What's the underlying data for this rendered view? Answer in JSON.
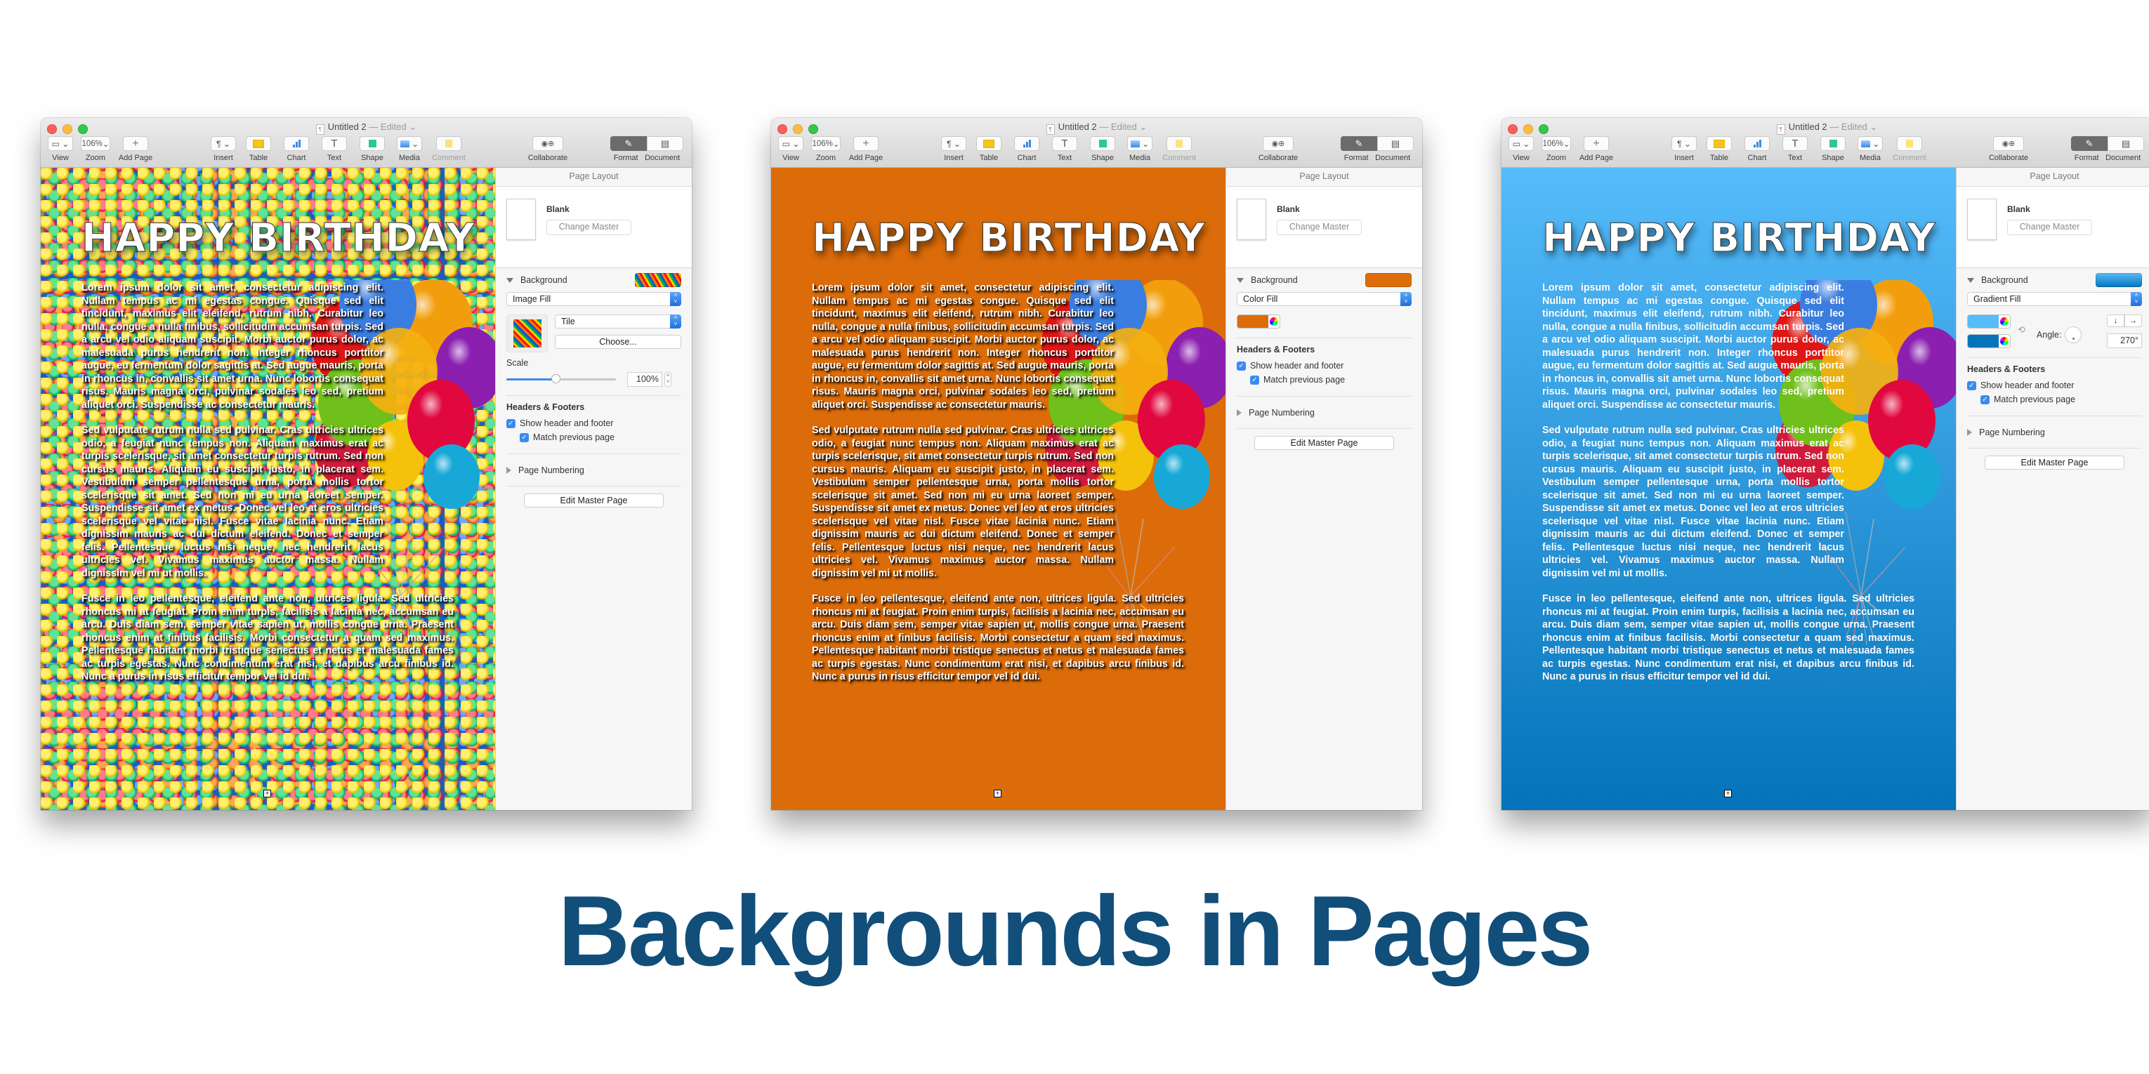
{
  "caption": "Backgrounds in Pages",
  "window": {
    "title": "Untitled 2",
    "title_separator": "—",
    "edited": "Edited",
    "toolbar": {
      "view": "View",
      "zoom_value": "106%",
      "zoom": "Zoom",
      "add_page": "Add Page",
      "insert": "Insert",
      "table": "Table",
      "chart": "Chart",
      "text": "Text",
      "shape": "Shape",
      "media": "Media",
      "comment": "Comment",
      "collaborate": "Collaborate",
      "format": "Format",
      "document": "Document"
    }
  },
  "document": {
    "heading": "HAPPY BIRTHDAY",
    "paragraphs": [
      "Lorem ipsum dolor sit amet, consectetur adipiscing elit. Nullam tempus ac mi egestas congue. Quisque sed elit tincidunt, maximus elit eleifend, rutrum nibh. Curabitur leo nulla, congue a nulla finibus, sollicitudin accumsan turpis. Sed a arcu vel odio aliquam suscipit. Morbi auctor purus dolor, ac malesuada purus hendrerit non. Integer rhoncus porttitor augue, eu fermentum dolor sagittis at. Sed augue mauris, porta in rhoncus in, convallis sit amet urna. Nunc lobortis consequat risus. Mauris magna orci, pulvinar sodales leo sed, pretium aliquet orci. Suspendisse ac consectetur mauris.",
      "Sed vulputate rutrum nulla sed pulvinar. Cras ultricies ultrices odio, a feugiat nunc tempus non. Aliquam maximus erat ac turpis scelerisque, sit amet consectetur turpis rutrum. Sed non cursus mauris. Aliquam eu suscipit justo, in placerat sem. Vestibulum semper pellentesque urna, porta mollis tortor scelerisque sit amet. Sed non mi eu urna laoreet semper. Suspendisse sit amet ex metus. Donec vel leo at eros ultricies scelerisque vel vitae nisl. Fusce vitae lacinia nunc. Etiam dignissim mauris ac dui dictum eleifend. Donec et semper felis. Pellentesque luctus nisi neque, nec hendrerit lacus ultricies vel. Vivamus maximus auctor massa. Nullam dignissim vel mi ut mollis.",
      "Fusce in leo pellentesque, eleifend ante non, ultrices ligula. Sed ultricies rhoncus mi at feugiat. Proin enim turpis, facilisis a lacinia nec, accumsan eu arcu. Duis diam sem, semper vitae sapien ut, mollis congue urna. Praesent rhoncus enim at finibus facilisis. Morbi consectetur a quam sed maximus. Pellentesque habitant morbi tristique senectus et netus et malesuada fames ac turpis egestas. Nunc condimentum erat nisi, et dapibus arcu finibus id. Nunc a purus in risus efficitur tempor vel id dui."
    ]
  },
  "sidebar": {
    "header": "Page Layout",
    "master_name": "Blank",
    "change_master": "Change Master",
    "background_label": "Background",
    "headers_footers": "Headers & Footers",
    "show_header_footer": "Show header and footer",
    "match_previous": "Match previous page",
    "page_numbering": "Page Numbering",
    "edit_master": "Edit Master Page"
  },
  "variants": [
    {
      "fill_type": "Image Fill",
      "image_mode": "Tile",
      "choose": "Choose...",
      "scale_label": "Scale",
      "scale_value": "100%",
      "scale_fraction": 0.45
    },
    {
      "fill_type": "Color Fill",
      "color": "#dc6c09"
    },
    {
      "fill_type": "Gradient Fill",
      "color_start": "#56bcfb",
      "color_end": "#0473ba",
      "angle_label": "Angle:",
      "angle_value": "270°"
    }
  ],
  "colors": {
    "caption": "#114e7a",
    "orange": "#dc6c09",
    "blue_light": "#56bcfb",
    "blue_dark": "#0473ba",
    "accent": "#3b8bef"
  }
}
